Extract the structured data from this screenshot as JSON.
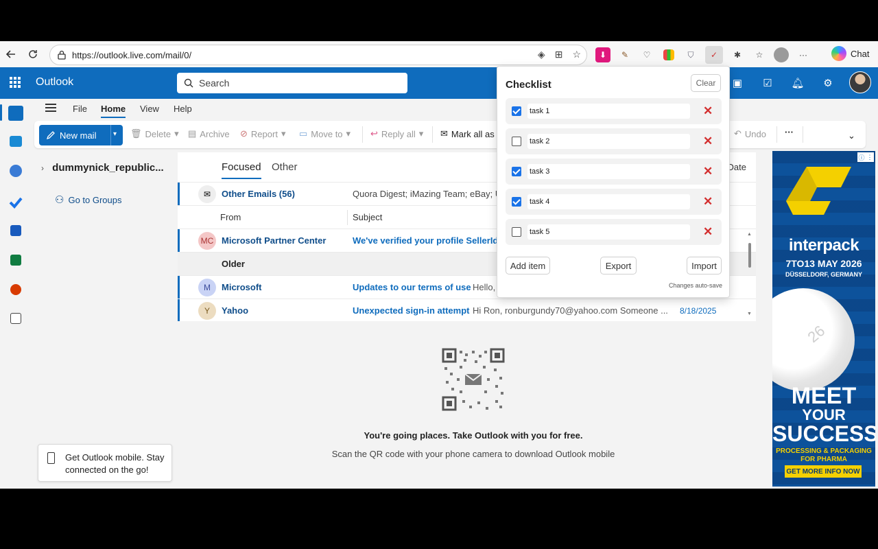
{
  "browser": {
    "url": "https://outlook.live.com/mail/0/",
    "chat_label": "Chat"
  },
  "app": {
    "title": "Outlook",
    "search_placeholder": "Search"
  },
  "menu": [
    "File",
    "Home",
    "View",
    "Help"
  ],
  "ribbon": {
    "new_mail": "New mail",
    "delete": "Delete",
    "archive": "Archive",
    "report": "Report",
    "move_to": "Move to",
    "reply_all": "Reply all",
    "mark_all": "Mark all as",
    "undo": "Undo",
    "more": "···"
  },
  "folder_pane": {
    "account": "dummynick_republic...",
    "go_to_groups": "Go to Groups"
  },
  "mail_list": {
    "tabs": [
      "Focused",
      "Other"
    ],
    "date_header": "Date",
    "other_emails": {
      "label": "Other Emails (56)",
      "preview": "Quora Digest; iMazing Team; eBay; U"
    },
    "col_from": "From",
    "col_subject": "Subject",
    "group_older": "Older",
    "messages": [
      {
        "initials": "MC",
        "sender": "Microsoft Partner Center",
        "subject": "We've verified your profile SellerId",
        "preview": "",
        "date": "",
        "color": "#f4c7c7",
        "text_color": "#a33"
      },
      {
        "initials": "M",
        "sender": "Microsoft",
        "subject": "Updates to our terms of use",
        "preview": "Hello,",
        "date": "",
        "color": "#c9d3f5",
        "text_color": "#3a4a9a"
      },
      {
        "initials": "Y",
        "sender": "Yahoo",
        "subject": "Unexpected sign-in attempt",
        "preview": "Hi Ron, ronburgundy70@yahoo.com Someone ...",
        "date": "8/18/2025",
        "color": "#ecdcc0",
        "text_color": "#7a5a20"
      }
    ]
  },
  "reading_pane": {
    "headline": "You're going places. Take Outlook with you for free.",
    "subline": "Scan the QR code with your phone camera to download Outlook mobile"
  },
  "mobile_card": "Get Outlook mobile. Stay connected on the go!",
  "ad": {
    "brand": "interpack",
    "date": "7TO13 MAY 2026",
    "place": "DÜSSELDORF, GERMANY",
    "meet": "MEET",
    "your": "YOUR",
    "success": "SUCCESS",
    "sub1": "PROCESSING & PACKAGING",
    "sub2": "FOR PHARMA",
    "cta": "GET MORE INFO NOW",
    "pill_text": "26"
  },
  "checklist": {
    "title": "Checklist",
    "clear": "Clear",
    "tasks": [
      {
        "label": "task 1",
        "checked": true
      },
      {
        "label": "task 2",
        "checked": false
      },
      {
        "label": "task 3",
        "checked": true
      },
      {
        "label": "task 4",
        "checked": true
      },
      {
        "label": "task 5",
        "checked": false
      }
    ],
    "delete_glyph": "✕",
    "add_item": "Add item",
    "export": "Export",
    "import": "Import",
    "autosave": "Changes auto-save"
  },
  "colors": {
    "brand": "#0f6cbd",
    "check": "#1a73e8",
    "delete": "#d32f2f"
  }
}
